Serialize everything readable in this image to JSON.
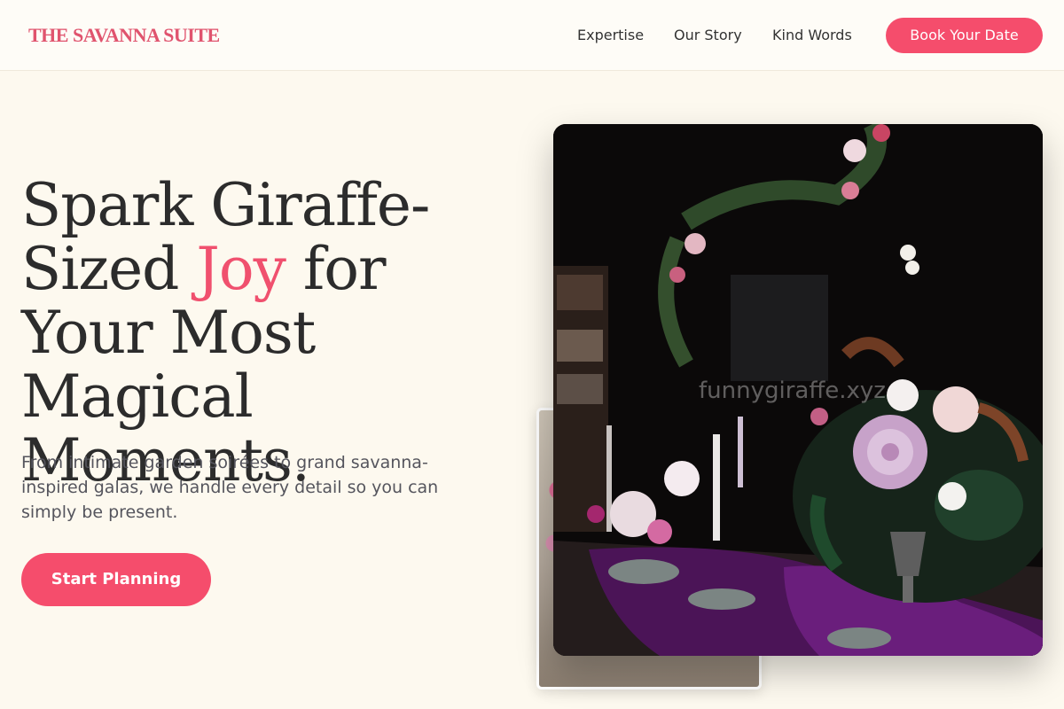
{
  "header": {
    "logo": "THE SAVANNA SUITE",
    "nav": [
      "Expertise",
      "Our Story",
      "Kind Words"
    ],
    "book_button": "Book Your Date"
  },
  "hero": {
    "title_before": "Spark Giraffe-Sized ",
    "title_accent": "Joy",
    "title_after": " for Your Most Magical Moments.",
    "subtitle": "From intimate garden soirées to grand savanna-inspired galas, we handle every detail so you can simply be present.",
    "cta": "Start Planning"
  },
  "image": {
    "watermark": "funnygiraffe.xyz",
    "main_alt_icon": "wedding-table-florals",
    "back_alt_icon": "wedding-venue-photo"
  },
  "colors": {
    "accent": "#f54d6c",
    "background": "#fdf9ef",
    "logo": "#e0546e"
  }
}
